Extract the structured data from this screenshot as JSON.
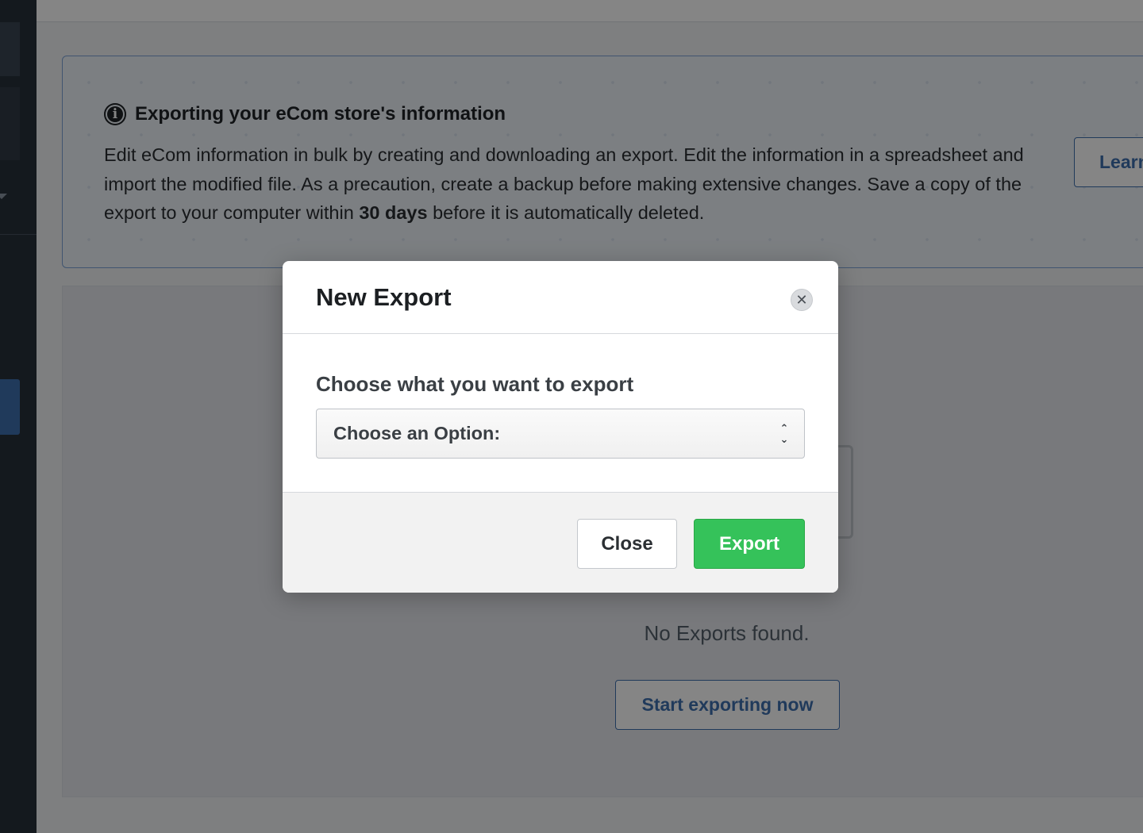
{
  "info_panel": {
    "icon": "info-icon",
    "title": "Exporting your eCom store's information",
    "text_part1": "Edit eCom information in bulk by creating and downloading an export. Edit the information in a spreadsheet and import the modified file. As a precaution, create a backup before making extensive changes. Save a copy of the export to your computer within ",
    "text_bold": "30 days",
    "text_part2": " before it is automatically deleted.",
    "learn_button_label": "Learn"
  },
  "exports_panel": {
    "empty_message": "No Exports found.",
    "start_button_label": "Start exporting now"
  },
  "modal": {
    "title": "New Export",
    "close_icon": "close-icon",
    "field_label": "Choose what you want to export",
    "select_value": "Choose an Option:",
    "close_button_label": "Close",
    "export_button_label": "Export"
  },
  "colors": {
    "primary_blue": "#3f6fae",
    "export_green": "#35c25a",
    "sidebar_dark": "#27303a"
  }
}
